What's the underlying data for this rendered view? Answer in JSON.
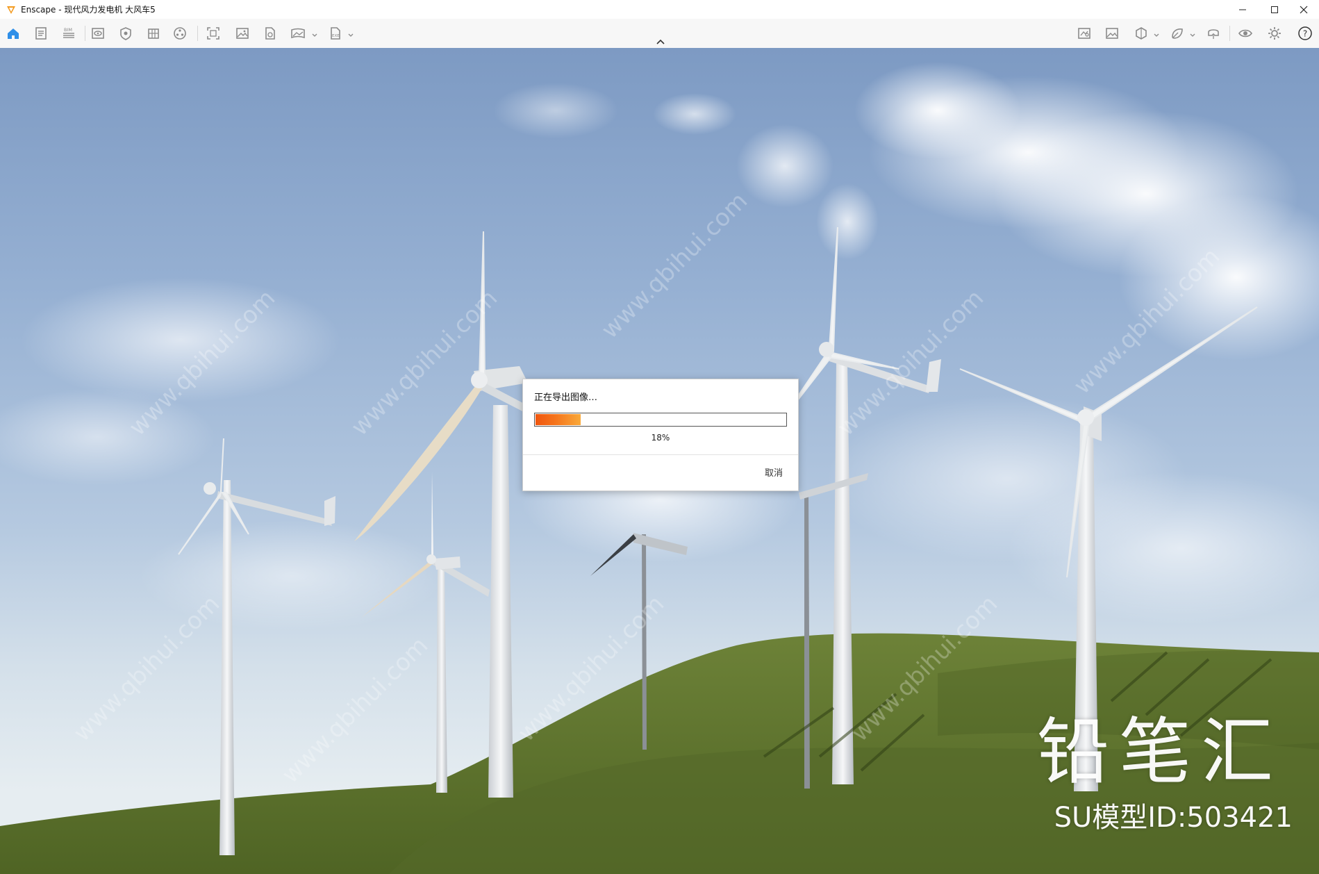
{
  "window": {
    "title": "Enscape - 现代风力发电机 大风车5",
    "brand_color": "#f39a1e"
  },
  "toolbar": {
    "left_icons": [
      "home-icon",
      "document-icon",
      "bim-icon",
      "view-icon",
      "visual-settings-icon",
      "building-icon",
      "asset-library-icon",
      "screenshot-icon",
      "image-icon",
      "export-file-icon",
      "panorama-icon",
      "exe-export-icon"
    ],
    "bim_label": "BIM",
    "exe_label": "EXE",
    "right_icons": [
      "map-icon",
      "gallery-icon",
      "cube-icon",
      "material-icon",
      "vr-headset-icon",
      "eye-icon",
      "settings-icon",
      "help-icon"
    ],
    "help_label": "?",
    "accent_color": "#2f8fe8"
  },
  "dialog": {
    "title": "正在导出图像…",
    "progress_label": "18%",
    "progress": 0.18,
    "cancel_label": "取消"
  },
  "watermark": {
    "brand": "铅笔汇",
    "model_id": "SU模型ID:503421"
  }
}
